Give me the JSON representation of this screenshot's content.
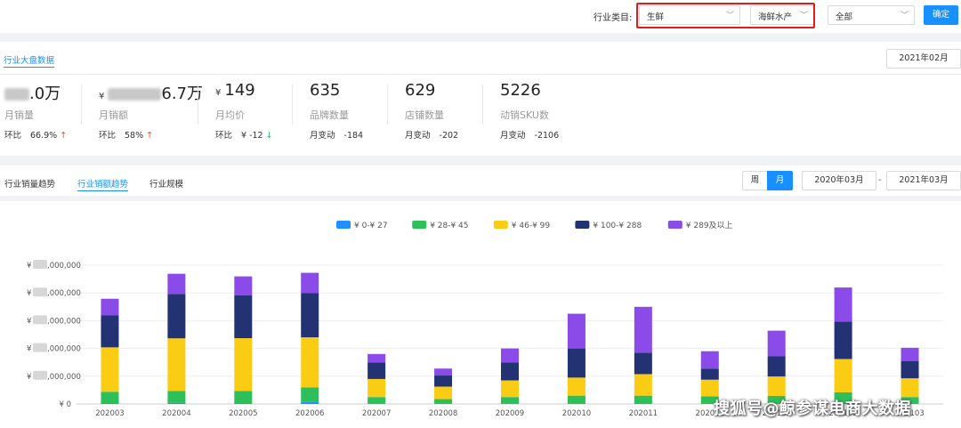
{
  "filter": {
    "label": "行业类目:",
    "category1": "生鲜",
    "category2": "海鲜水产",
    "category3": "全部",
    "confirm": "确定"
  },
  "overview": {
    "tab": "行业大盘数据",
    "month": "2021年02月",
    "kpis": [
      {
        "currency": "",
        "value_visible": ".0万",
        "name": "月销量",
        "change_label": "环比",
        "change_value": "66.9%",
        "arrow": "↑"
      },
      {
        "currency": "¥",
        "value_visible": "6.7万",
        "name": "月销额",
        "change_label": "环比",
        "change_value": "58%",
        "arrow": "↑"
      },
      {
        "currency": "¥",
        "value_visible": "149",
        "name": "月均价",
        "change_label": "环比",
        "change_value": "¥ -12",
        "arrow": "↓"
      },
      {
        "currency": "",
        "value_visible": "635",
        "name": "品牌数量",
        "change_label": "月变动",
        "change_value": "-184",
        "arrow": ""
      },
      {
        "currency": "",
        "value_visible": "629",
        "name": "店铺数量",
        "change_label": "月变动",
        "change_value": "-202",
        "arrow": ""
      },
      {
        "currency": "",
        "value_visible": "5226",
        "name": "动销SKU数",
        "change_label": "月变动",
        "change_value": "-2106",
        "arrow": ""
      }
    ]
  },
  "trend": {
    "tabs": [
      "行业销量趋势",
      "行业销额趋势",
      "行业规模"
    ],
    "active_tab": 1,
    "period_week": "周",
    "period_month": "月",
    "start": "2020年03月",
    "end": "2021年03月",
    "range_sep": "-"
  },
  "chart_data": {
    "type": "bar",
    "stacked": true,
    "categories": [
      "202003",
      "202004",
      "202005",
      "202006",
      "202007",
      "202008",
      "202009",
      "202010",
      "202011",
      "202012",
      "202101",
      "202102",
      "202103"
    ],
    "x_tick_labels": [
      "202003",
      "202004",
      "202005",
      "202006",
      "202007",
      "202008",
      "202009",
      "202010",
      "202011",
      "202012",
      "202101",
      "202102",
      "202103"
    ],
    "series": [
      {
        "name": "¥ 0-¥ 27",
        "color": "#1e90ff",
        "values": [
          0.06,
          0.08,
          0.06,
          0.15,
          0.0,
          0.0,
          0.0,
          0.0,
          0.0,
          0.0,
          0.0,
          0.06,
          0.0
        ]
      },
      {
        "name": "¥ 28-¥ 45",
        "color": "#2dbf5a",
        "values": [
          0.82,
          0.85,
          0.88,
          1.05,
          0.5,
          0.35,
          0.5,
          0.6,
          0.6,
          0.55,
          0.58,
          0.78,
          0.5
        ]
      },
      {
        "name": "¥ 46-¥ 99",
        "color": "#facc14",
        "values": [
          3.2,
          3.8,
          3.8,
          3.6,
          1.3,
          0.9,
          1.2,
          1.3,
          1.55,
          1.2,
          1.4,
          2.4,
          1.35
        ]
      },
      {
        "name": "¥ 100-¥ 288",
        "color": "#223273",
        "values": [
          2.3,
          3.2,
          3.1,
          3.2,
          1.2,
          0.8,
          1.3,
          2.1,
          1.55,
          0.8,
          1.45,
          2.7,
          1.25
        ]
      },
      {
        "name": "¥ 289及以上",
        "color": "#8a4be8",
        "values": [
          1.2,
          1.45,
          1.35,
          1.45,
          0.6,
          0.5,
          1.0,
          2.5,
          3.3,
          1.25,
          1.85,
          2.45,
          0.95
        ]
      }
    ],
    "ylim": [
      0,
      10
    ],
    "y_tick_labels": [
      "¥ 0",
      "",
      "",
      "",
      "",
      ""
    ],
    "y_tick_suffixes": [
      "",
      ",000,000",
      ",000,000",
      ",000,000",
      ",000,000",
      ",000,000"
    ],
    "legend_position": "top-center",
    "grid": true
  },
  "watermark": "搜狐号@鲸参谋电商大数据"
}
